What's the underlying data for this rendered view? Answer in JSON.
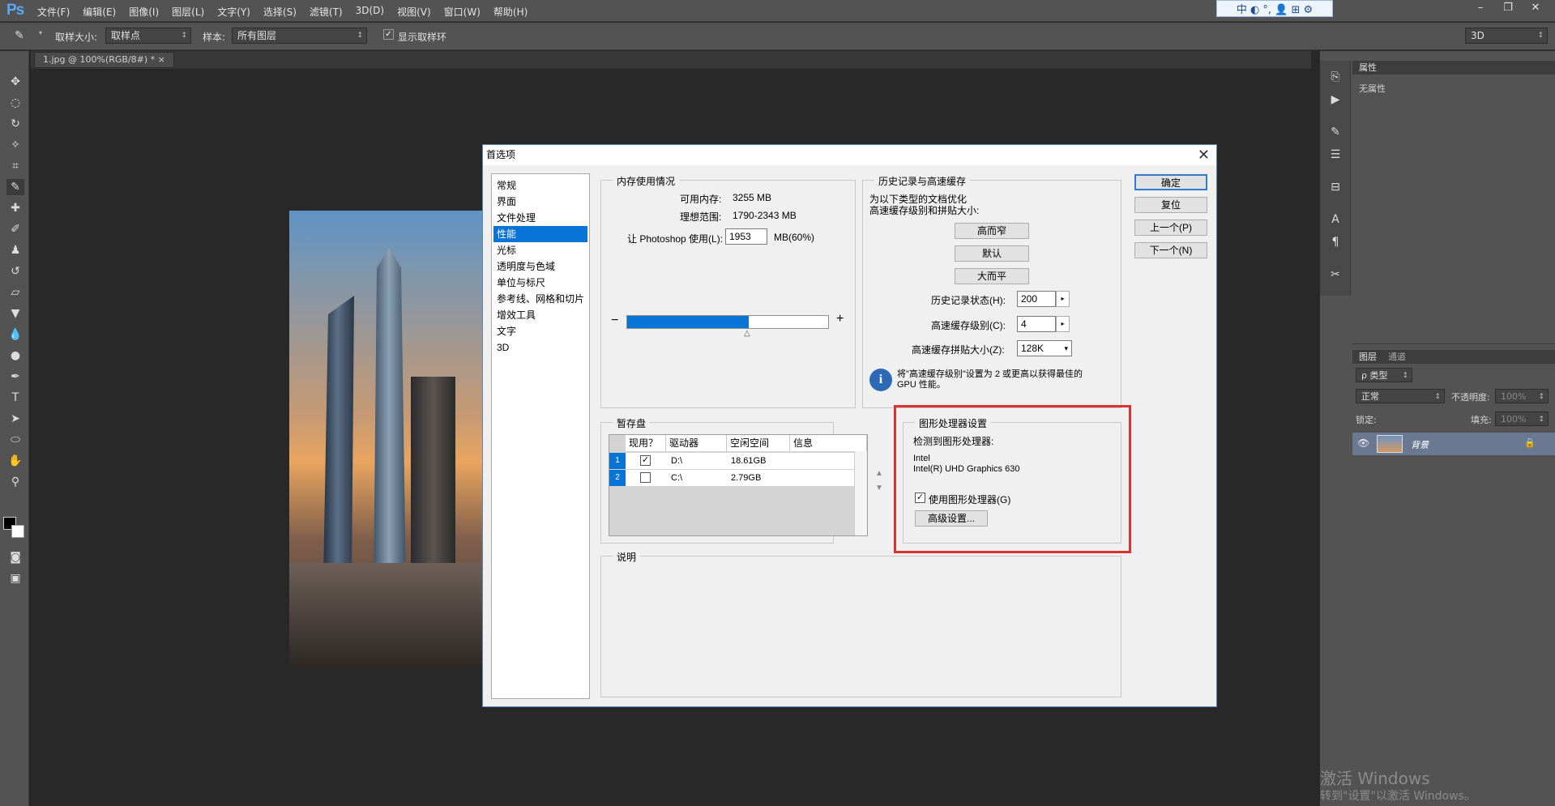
{
  "app": {
    "logo": "Ps"
  },
  "menubar": {
    "items": [
      "文件(F)",
      "编辑(E)",
      "图像(I)",
      "图层(L)",
      "文字(Y)",
      "选择(S)",
      "滤镜(T)",
      "3D(D)",
      "视图(V)",
      "窗口(W)",
      "帮助(H)"
    ]
  },
  "ime": {
    "text": "中 ◐ °, 👤 ⊞ ⚙"
  },
  "options": {
    "sample_size_label": "取样大小:",
    "sample_size_value": "取样点",
    "sample_label": "样本:",
    "sample_value": "所有图层",
    "show_ring_label": "显示取样环",
    "workspace": "3D"
  },
  "doc": {
    "tab": "1.jpg @ 100%(RGB/8#) *"
  },
  "panels": {
    "properties_title": "属性",
    "properties_empty": "无属性",
    "layers_tab": "图层",
    "channels_tab": "通道",
    "kind": "ρ 类型",
    "blend": "正常",
    "opacity_label": "不透明度:",
    "opacity_value": "100%",
    "lock_label": "锁定:",
    "fill_label": "填充:",
    "fill_value": "100%",
    "layer_name": "背景"
  },
  "dialog": {
    "title": "首选项",
    "categories": [
      "常规",
      "界面",
      "文件处理",
      "性能",
      "光标",
      "透明度与色域",
      "单位与标尺",
      "参考线、网格和切片",
      "增效工具",
      "文字",
      "3D"
    ],
    "active_category": "性能",
    "memory": {
      "title": "内存使用情况",
      "avail_label": "可用内存:",
      "avail_value": "3255 MB",
      "ideal_label": "理想范围:",
      "ideal_value": "1790-2343 MB",
      "let_label": "让 Photoshop 使用(L):",
      "let_value": "1953",
      "let_unit": "MB(60%)",
      "minus": "−",
      "plus": "+",
      "slider_fraction": 0.6
    },
    "history": {
      "title": "历史记录与高速缓存",
      "desc1": "为以下类型的文档优化",
      "desc2": "高速缓存级别和拼贴大小:",
      "btn_tall": "高而窄",
      "btn_default": "默认",
      "btn_big": "大而平",
      "states_label": "历史记录状态(H):",
      "states_value": "200",
      "levels_label": "高速缓存级别(C):",
      "levels_value": "4",
      "tile_label": "高速缓存拼贴大小(Z):",
      "tile_value": "128K",
      "note1": "将\"高速缓存级别\"设置为 2 或更高以获得最佳的",
      "note2": "GPU 性能。"
    },
    "scratch": {
      "title": "暂存盘",
      "headers": [
        "现用？",
        "驱动器",
        "空闲空间",
        "信息"
      ],
      "rows": [
        {
          "num": "1",
          "checked": "✓",
          "drive": "D:\\",
          "free": "18.61GB",
          "info": ""
        },
        {
          "num": "2",
          "checked": "",
          "drive": "C:\\",
          "free": "2.79GB",
          "info": ""
        }
      ]
    },
    "gpu": {
      "title": "图形处理器设置",
      "detected_label": "检测到图形处理器:",
      "vendor": "Intel",
      "model": "Intel(R) UHD Graphics 630",
      "use_label": "使用图形处理器(G)",
      "use_checked": "✓",
      "advanced": "高级设置..."
    },
    "description": {
      "title": "说明"
    },
    "buttons": {
      "ok": "确定",
      "reset": "复位",
      "prev": "上一个(P)",
      "next": "下一个(N)"
    }
  },
  "watermarks": {
    "activate": "激活 Windows",
    "activate_sub": "转到\"设置\"以激活 Windows。"
  }
}
